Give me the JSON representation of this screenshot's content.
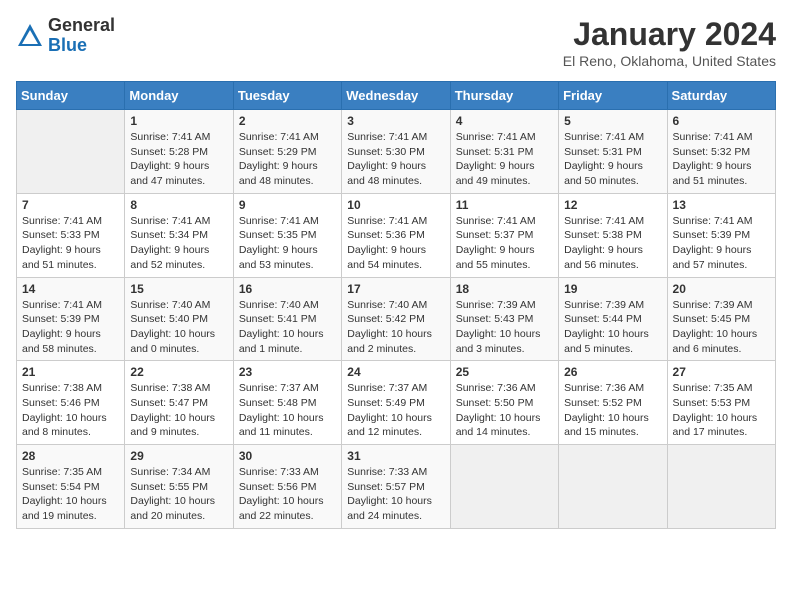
{
  "header": {
    "logo_line1": "General",
    "logo_line2": "Blue",
    "title": "January 2024",
    "subtitle": "El Reno, Oklahoma, United States"
  },
  "weekdays": [
    "Sunday",
    "Monday",
    "Tuesday",
    "Wednesday",
    "Thursday",
    "Friday",
    "Saturday"
  ],
  "weeks": [
    [
      {
        "day": "",
        "info": ""
      },
      {
        "day": "1",
        "info": "Sunrise: 7:41 AM\nSunset: 5:28 PM\nDaylight: 9 hours\nand 47 minutes."
      },
      {
        "day": "2",
        "info": "Sunrise: 7:41 AM\nSunset: 5:29 PM\nDaylight: 9 hours\nand 48 minutes."
      },
      {
        "day": "3",
        "info": "Sunrise: 7:41 AM\nSunset: 5:30 PM\nDaylight: 9 hours\nand 48 minutes."
      },
      {
        "day": "4",
        "info": "Sunrise: 7:41 AM\nSunset: 5:31 PM\nDaylight: 9 hours\nand 49 minutes."
      },
      {
        "day": "5",
        "info": "Sunrise: 7:41 AM\nSunset: 5:31 PM\nDaylight: 9 hours\nand 50 minutes."
      },
      {
        "day": "6",
        "info": "Sunrise: 7:41 AM\nSunset: 5:32 PM\nDaylight: 9 hours\nand 51 minutes."
      }
    ],
    [
      {
        "day": "7",
        "info": "Sunrise: 7:41 AM\nSunset: 5:33 PM\nDaylight: 9 hours\nand 51 minutes."
      },
      {
        "day": "8",
        "info": "Sunrise: 7:41 AM\nSunset: 5:34 PM\nDaylight: 9 hours\nand 52 minutes."
      },
      {
        "day": "9",
        "info": "Sunrise: 7:41 AM\nSunset: 5:35 PM\nDaylight: 9 hours\nand 53 minutes."
      },
      {
        "day": "10",
        "info": "Sunrise: 7:41 AM\nSunset: 5:36 PM\nDaylight: 9 hours\nand 54 minutes."
      },
      {
        "day": "11",
        "info": "Sunrise: 7:41 AM\nSunset: 5:37 PM\nDaylight: 9 hours\nand 55 minutes."
      },
      {
        "day": "12",
        "info": "Sunrise: 7:41 AM\nSunset: 5:38 PM\nDaylight: 9 hours\nand 56 minutes."
      },
      {
        "day": "13",
        "info": "Sunrise: 7:41 AM\nSunset: 5:39 PM\nDaylight: 9 hours\nand 57 minutes."
      }
    ],
    [
      {
        "day": "14",
        "info": "Sunrise: 7:41 AM\nSunset: 5:39 PM\nDaylight: 9 hours\nand 58 minutes."
      },
      {
        "day": "15",
        "info": "Sunrise: 7:40 AM\nSunset: 5:40 PM\nDaylight: 10 hours\nand 0 minutes."
      },
      {
        "day": "16",
        "info": "Sunrise: 7:40 AM\nSunset: 5:41 PM\nDaylight: 10 hours\nand 1 minute."
      },
      {
        "day": "17",
        "info": "Sunrise: 7:40 AM\nSunset: 5:42 PM\nDaylight: 10 hours\nand 2 minutes."
      },
      {
        "day": "18",
        "info": "Sunrise: 7:39 AM\nSunset: 5:43 PM\nDaylight: 10 hours\nand 3 minutes."
      },
      {
        "day": "19",
        "info": "Sunrise: 7:39 AM\nSunset: 5:44 PM\nDaylight: 10 hours\nand 5 minutes."
      },
      {
        "day": "20",
        "info": "Sunrise: 7:39 AM\nSunset: 5:45 PM\nDaylight: 10 hours\nand 6 minutes."
      }
    ],
    [
      {
        "day": "21",
        "info": "Sunrise: 7:38 AM\nSunset: 5:46 PM\nDaylight: 10 hours\nand 8 minutes."
      },
      {
        "day": "22",
        "info": "Sunrise: 7:38 AM\nSunset: 5:47 PM\nDaylight: 10 hours\nand 9 minutes."
      },
      {
        "day": "23",
        "info": "Sunrise: 7:37 AM\nSunset: 5:48 PM\nDaylight: 10 hours\nand 11 minutes."
      },
      {
        "day": "24",
        "info": "Sunrise: 7:37 AM\nSunset: 5:49 PM\nDaylight: 10 hours\nand 12 minutes."
      },
      {
        "day": "25",
        "info": "Sunrise: 7:36 AM\nSunset: 5:50 PM\nDaylight: 10 hours\nand 14 minutes."
      },
      {
        "day": "26",
        "info": "Sunrise: 7:36 AM\nSunset: 5:52 PM\nDaylight: 10 hours\nand 15 minutes."
      },
      {
        "day": "27",
        "info": "Sunrise: 7:35 AM\nSunset: 5:53 PM\nDaylight: 10 hours\nand 17 minutes."
      }
    ],
    [
      {
        "day": "28",
        "info": "Sunrise: 7:35 AM\nSunset: 5:54 PM\nDaylight: 10 hours\nand 19 minutes."
      },
      {
        "day": "29",
        "info": "Sunrise: 7:34 AM\nSunset: 5:55 PM\nDaylight: 10 hours\nand 20 minutes."
      },
      {
        "day": "30",
        "info": "Sunrise: 7:33 AM\nSunset: 5:56 PM\nDaylight: 10 hours\nand 22 minutes."
      },
      {
        "day": "31",
        "info": "Sunrise: 7:33 AM\nSunset: 5:57 PM\nDaylight: 10 hours\nand 24 minutes."
      },
      {
        "day": "",
        "info": ""
      },
      {
        "day": "",
        "info": ""
      },
      {
        "day": "",
        "info": ""
      }
    ]
  ]
}
